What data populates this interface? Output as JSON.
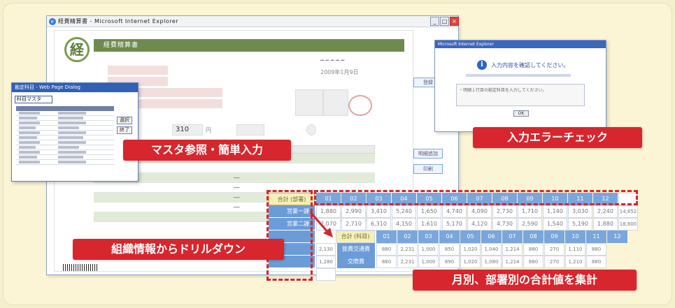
{
  "window": {
    "title": "経費精算書 - Microsoft Internet Explorer"
  },
  "form": {
    "logo_char": "経",
    "header": "経費精算書",
    "date": "2009年1月9日",
    "yen_sign": "円",
    "amount": "310"
  },
  "popup": {
    "title": "勘定科目 - Web Page Dialog",
    "list_title": "科目マスタ",
    "btn_select": "選択",
    "btn_close": "終了"
  },
  "dialog": {
    "title": "Microsoft Internet Explorer",
    "message": "入力内容を確認してください。",
    "body": "・明細１行目の勘定科目を入力してください。"
  },
  "summary": {
    "label": "合計 (部署)",
    "months": [
      "01",
      "02",
      "03",
      "04",
      "05",
      "06",
      "07",
      "08",
      "09",
      "10",
      "11",
      "12"
    ],
    "rows": [
      {
        "label": "営業一課",
        "values": [
          "1,880",
          "2,990",
          "3,410",
          "5,240",
          "1,650",
          "4,740",
          "4,090",
          "2,730",
          "1,710",
          "1,140",
          "3,030",
          "2,240"
        ],
        "total": "14,852"
      },
      {
        "label": "営業二課",
        "values": [
          "2,070",
          "2,710",
          "6,310",
          "4,150",
          "1,610",
          "5,170",
          "4,120",
          "4,730",
          "2,590",
          "1,540",
          "5,190",
          "1,880"
        ],
        "total": "18,800"
      }
    ],
    "sub_label": "合計 (科目)",
    "sub_rows": [
      {
        "left": "2,130",
        "label": "旅費交通費",
        "values": [
          "880",
          "2,231",
          "1,000",
          "850",
          "1,020",
          "1,040",
          "1,214",
          "880",
          "270",
          "1,110",
          "880"
        ]
      },
      {
        "left": "1,280",
        "label": "交際費",
        "values": [
          "880",
          "2,231",
          "1,000",
          "890",
          "1,020",
          "1,080",
          "1,214",
          "880",
          "270",
          "1,210",
          "880"
        ]
      }
    ]
  },
  "callouts": {
    "master": "マスタ参照・簡単入力",
    "error": "入力エラーチェック",
    "drill": "組織情報からドリルダウン",
    "total": "月別、部署別の合計値を集計"
  },
  "side_buttons": [
    "登録",
    "明細追加",
    "印刷"
  ]
}
